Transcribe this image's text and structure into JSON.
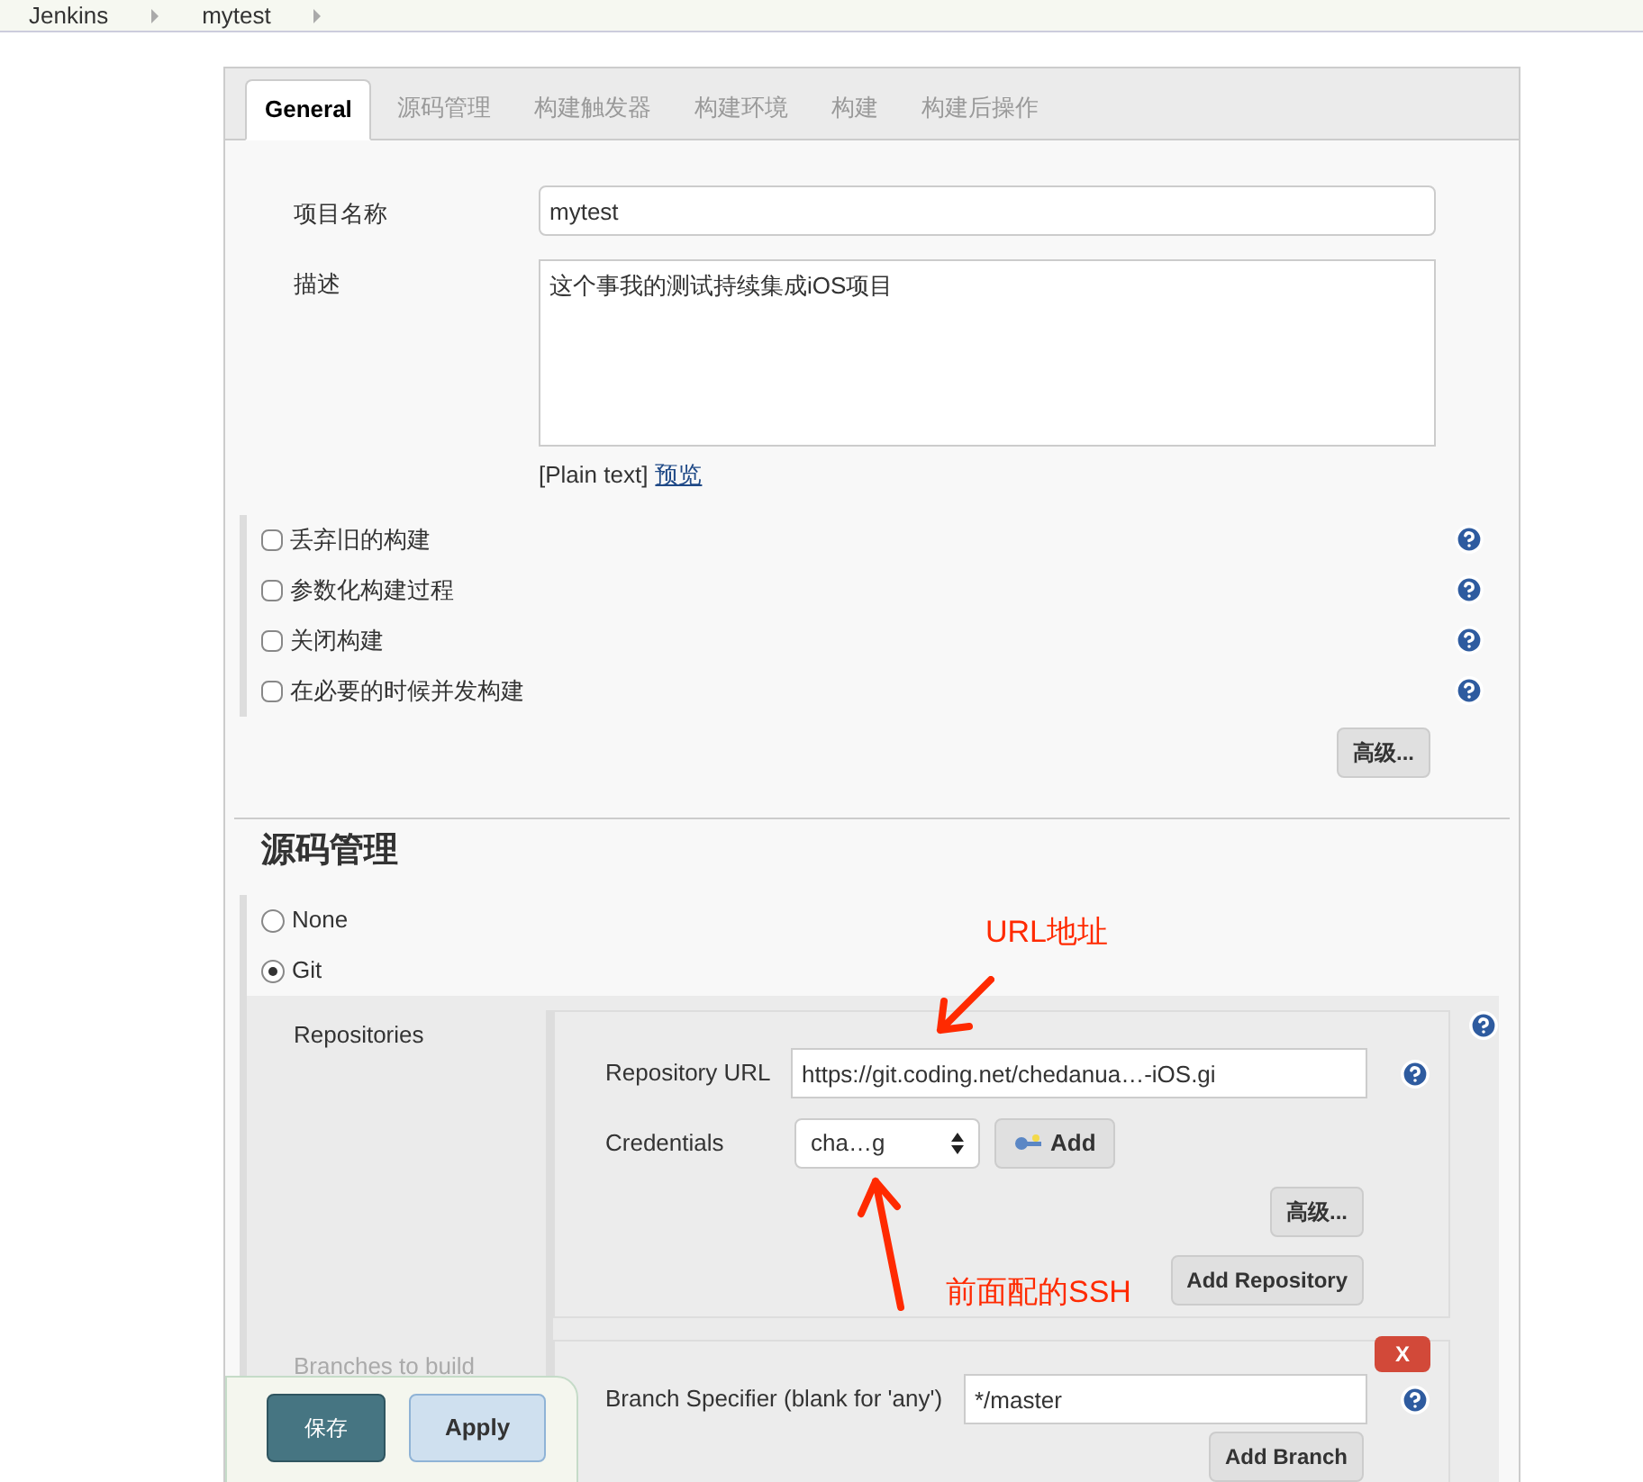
{
  "breadcrumbs": [
    "Jenkins",
    "mytest"
  ],
  "tabs": [
    {
      "label": "General",
      "selected": true
    },
    {
      "label": "源码管理",
      "selected": false
    },
    {
      "label": "构建触发器",
      "selected": false
    },
    {
      "label": "构建环境",
      "selected": false
    },
    {
      "label": "构建",
      "selected": false
    },
    {
      "label": "构建后操作",
      "selected": false
    }
  ],
  "general": {
    "name_label": "项目名称",
    "name_value": "mytest",
    "description_label": "描述",
    "description_value": "这个事我的测试持续集成iOS项目",
    "format": "[Plain text]",
    "preview_link": "预览",
    "options": [
      {
        "label": "丢弃旧的构建",
        "checked": false
      },
      {
        "label": "参数化构建过程",
        "checked": false
      },
      {
        "label": "关闭构建",
        "checked": false
      },
      {
        "label": "在必要的时候并发构建",
        "checked": false
      }
    ],
    "advanced_button": "高级..."
  },
  "scm": {
    "heading": "源码管理",
    "options": [
      {
        "label": "None",
        "selected": false
      },
      {
        "label": "Git",
        "selected": true
      }
    ],
    "repositories": {
      "label": "Repositories",
      "url_label": "Repository URL",
      "url_value": "https://git.coding.net/chedanua…-iOS.gi",
      "credentials_label": "Credentials",
      "credentials_value": "cha…g",
      "add_button": "Add",
      "advanced_button": "高级...",
      "add_repository_button": "Add Repository"
    },
    "branches": {
      "label": "Branches to build",
      "remove_button": "X",
      "specifier_label": "Branch Specifier (blank for 'any')",
      "specifier_value": "*/master",
      "add_branch_button": "Add Branch"
    }
  },
  "annotations": [
    {
      "text": "URL地址",
      "kind": "down"
    },
    {
      "text": "前面配的SSH",
      "kind": "up"
    }
  ],
  "actions": {
    "save": "保存",
    "apply": "Apply"
  }
}
